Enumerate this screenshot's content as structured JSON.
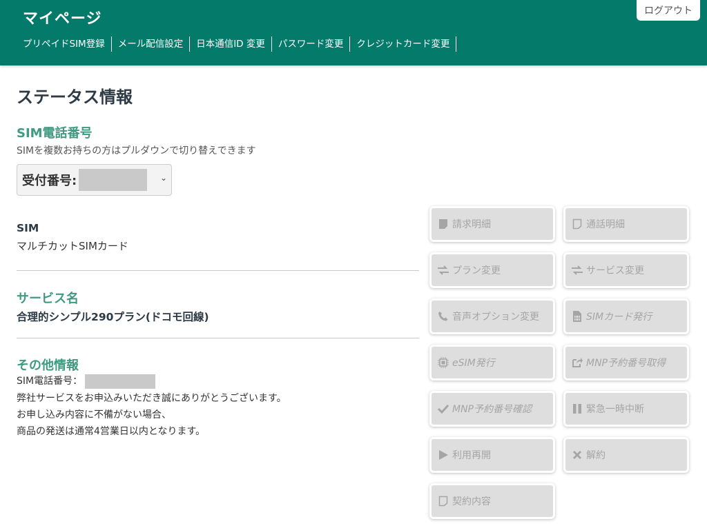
{
  "header": {
    "title": "マイページ",
    "logout_label": "ログアウト",
    "nav": [
      "プリペイドSIM登録",
      "メール配信設定",
      "日本通信ID 変更",
      "パスワード変更",
      "クレジットカード変更"
    ]
  },
  "main": {
    "page_title": "ステータス情報",
    "sim_number": {
      "heading": "SIM電話番号",
      "help": "SIMを複数お持ちの方はプルダウンで切り替えできます",
      "select_label": "受付番号:"
    },
    "sim": {
      "heading": "SIM",
      "value": "マルチカットSIMカード"
    },
    "service": {
      "heading": "サービス名",
      "value": "合理的シンプル290プラン(ドコモ回線)"
    },
    "other": {
      "heading": "その他情報",
      "phone_label": "SIM電話番号：",
      "line1": "弊社サービスをお申込みいただき誠にありがとうございます。",
      "line2": "お申し込み内容に不備がない場合、",
      "line3": "商品の発送は通常4営業日以内となります。"
    }
  },
  "actions": {
    "billing": "請求明細",
    "call_details": "通話明細",
    "plan_change": "プラン変更",
    "service_change": "サービス変更",
    "voice_option": "音声オプション変更",
    "sim_card_issue": "SIMカード発行",
    "esim_issue": "eSIM発行",
    "mnp_get": "MNP予約番号取得",
    "mnp_confirm": "MNP予約番号確認",
    "suspend": "緊急一時中断",
    "resume": "利用再開",
    "cancel": "解約",
    "contract": "契約内容"
  },
  "colors": {
    "header_bg": "#047a6b",
    "heading_green": "#3f9a82",
    "button_bg": "#dedede",
    "button_text": "#a5a5a5"
  }
}
